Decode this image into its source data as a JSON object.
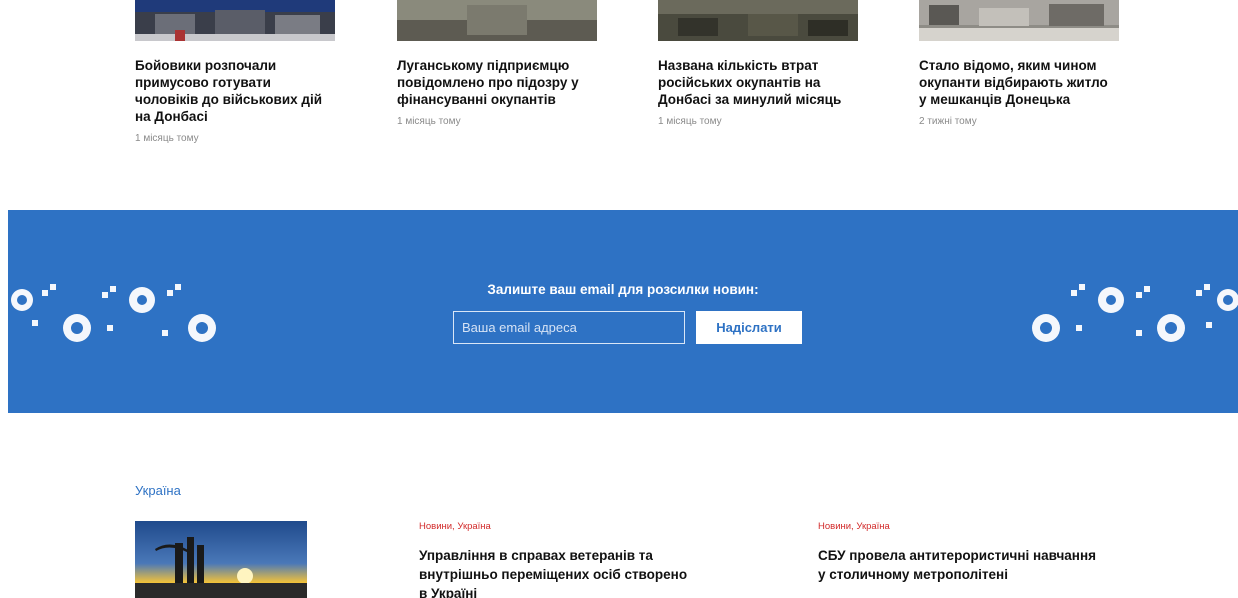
{
  "top_news": [
    {
      "title": "Бойовики розпочали примусово готувати чоловіків до військових дій на Донбасі",
      "time": "1 місяць тому"
    },
    {
      "title": "Луганському підприємцю повідомлено про підозру у фінансуванні окупантів",
      "time": "1 місяць тому"
    },
    {
      "title": "Названа кількість втрат російських окупантів на Донбасі за минулий місяць",
      "time": "1 місяць тому"
    },
    {
      "title": "Стало відомо, яким чином окупанти відбирають житло у мешканців Донецька",
      "time": "2 тижні тому"
    }
  ],
  "newsletter": {
    "heading": "Залиште ваш email для розсилки новин:",
    "email_placeholder": "Ваша email адреса",
    "submit_label": "Надіслати",
    "background_color": "#2e72c4"
  },
  "ukraine_section": {
    "title": "Україна",
    "articles": [
      {
        "category": "Новини, Україна",
        "title": "Управління в справах ветеранів та внутрішньо переміщених осіб створено в Україні"
      },
      {
        "category": "Новини, Україна",
        "title": "СБУ провела антитерористичні навчання у столичному метрополітені"
      }
    ]
  },
  "colors": {
    "accent": "#2e72c4",
    "category": "#d22a2a",
    "meta": "#8a8a8a"
  }
}
